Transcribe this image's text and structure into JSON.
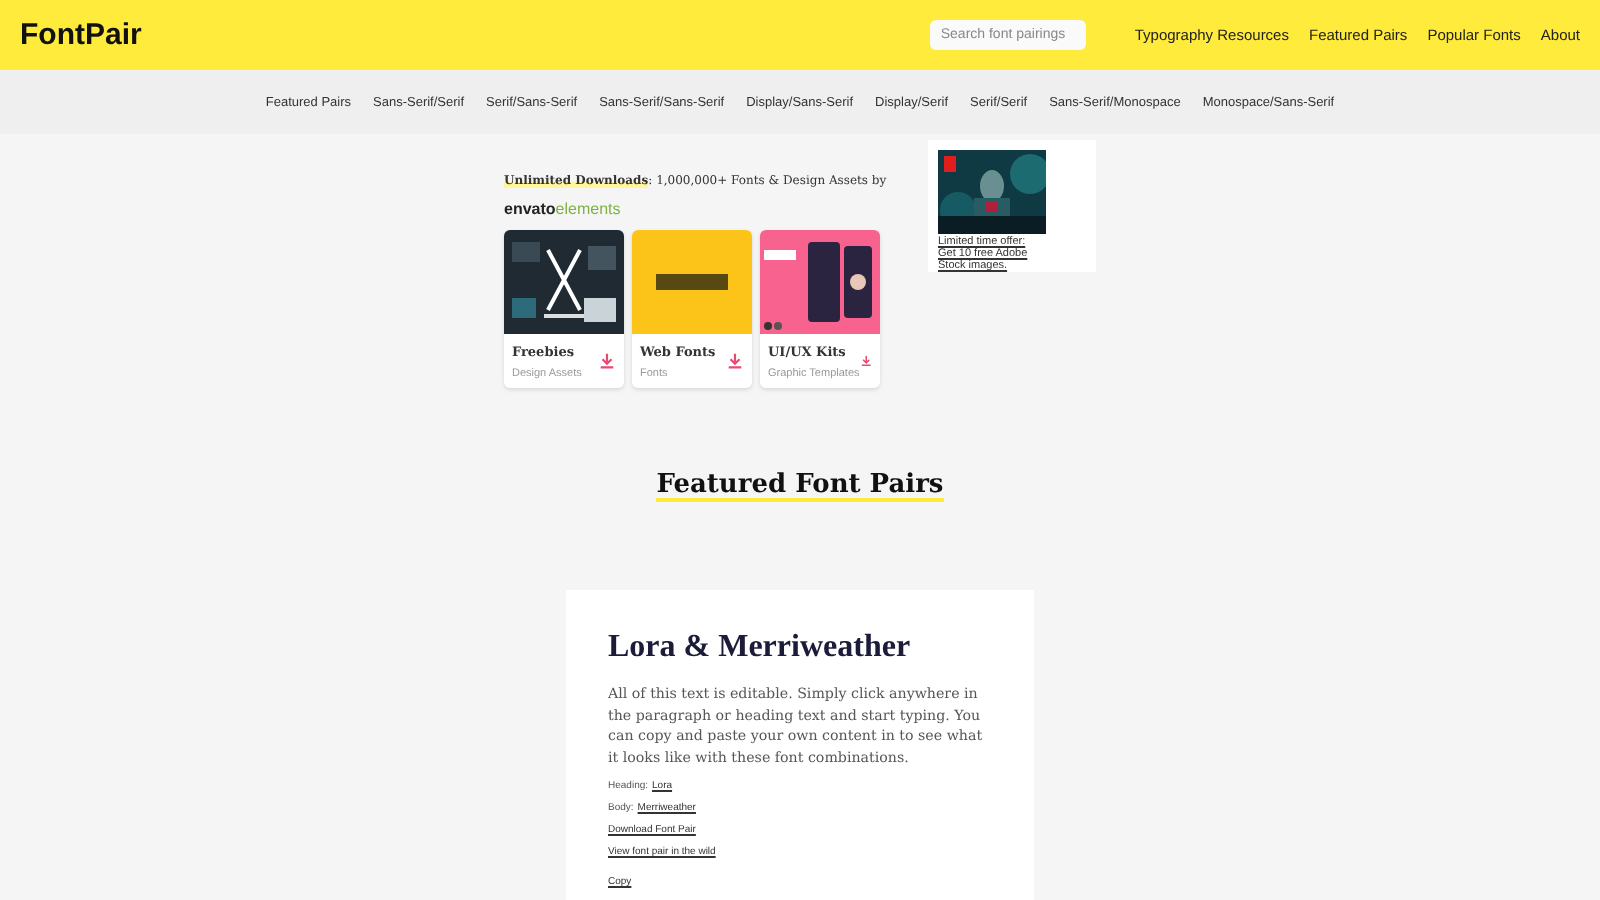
{
  "header": {
    "logo": "FontPair",
    "search": {
      "placeholder": "Search font pairings"
    },
    "links": [
      "Typography Resources",
      "Featured Pairs",
      "Popular Fonts",
      "About"
    ]
  },
  "categories": [
    "Featured Pairs",
    "Sans-Serif/Serif",
    "Serif/Sans-Serif",
    "Sans-Serif/Sans-Serif",
    "Display/Sans-Serif",
    "Display/Serif",
    "Serif/Serif",
    "Sans-Serif/Monospace",
    "Monospace/Sans-Serif"
  ],
  "promo": {
    "headline": "**Unlimited Downloads**: 1,000,000+ Fonts & Design Assets by",
    "brand": [
      "envato",
      "elements"
    ],
    "cards": [
      {
        "title": "Freebies",
        "subtitle": "Design Assets",
        "kind": "dark"
      },
      {
        "title": "Web Fonts",
        "subtitle": "Fonts",
        "kind": "yellow"
      },
      {
        "title": "UI/UX Kits",
        "subtitle": "Graphic Templates",
        "kind": "pink"
      }
    ]
  },
  "ad": {
    "link": "Limited time offer: Get 10 free Adobe Stock images."
  },
  "section_title": "Featured Font Pairs",
  "pair": {
    "title": "Lora & Merriweather",
    "body": "All of this text is editable. Simply click anywhere in the paragraph or heading text and start typing. You can copy and paste your own content in to see what it looks like with these font combinations.",
    "heading_label": "Heading:",
    "heading_font": "Lora",
    "body_label": "Body:",
    "body_font": "Merriweather",
    "download": "Download Font Pair",
    "wild": "View font pair in the wild",
    "copy": "Copy"
  }
}
